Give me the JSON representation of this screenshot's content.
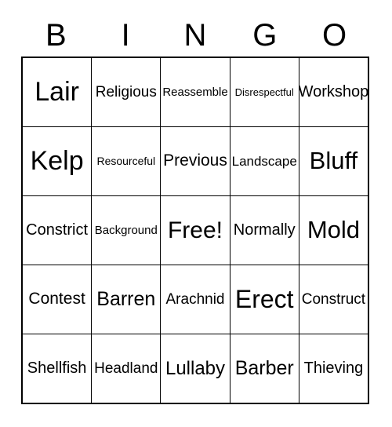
{
  "card": {
    "header": {
      "letters": [
        "B",
        "I",
        "N",
        "G",
        "O"
      ]
    },
    "rows": [
      {
        "cells": [
          {
            "text": "Lair",
            "size": 34
          },
          {
            "text": "Religious",
            "size": 19
          },
          {
            "text": "Reassemble",
            "size": 15
          },
          {
            "text": "Disrespectful",
            "size": 13
          },
          {
            "text": "Workshop",
            "size": 20
          }
        ]
      },
      {
        "cells": [
          {
            "text": "Kelp",
            "size": 34
          },
          {
            "text": "Resourceful",
            "size": 14
          },
          {
            "text": "Previous",
            "size": 21
          },
          {
            "text": "Landscape",
            "size": 17
          },
          {
            "text": "Bluff",
            "size": 31
          }
        ]
      },
      {
        "cells": [
          {
            "text": "Constrict",
            "size": 20
          },
          {
            "text": "Background",
            "size": 15
          },
          {
            "text": "Free!",
            "size": 30
          },
          {
            "text": "Normally",
            "size": 20
          },
          {
            "text": "Mold",
            "size": 31
          }
        ]
      },
      {
        "cells": [
          {
            "text": "Contest",
            "size": 21
          },
          {
            "text": "Barren",
            "size": 25
          },
          {
            "text": "Arachnid",
            "size": 19
          },
          {
            "text": "Erect",
            "size": 32
          },
          {
            "text": "Construct",
            "size": 19
          }
        ]
      },
      {
        "cells": [
          {
            "text": "Shellfish",
            "size": 20
          },
          {
            "text": "Headland",
            "size": 19
          },
          {
            "text": "Lullaby",
            "size": 24
          },
          {
            "text": "Barber",
            "size": 25
          },
          {
            "text": "Thieving",
            "size": 20
          }
        ]
      }
    ]
  },
  "colors": {
    "border": "#000000",
    "text": "#000000",
    "background": "#ffffff"
  }
}
